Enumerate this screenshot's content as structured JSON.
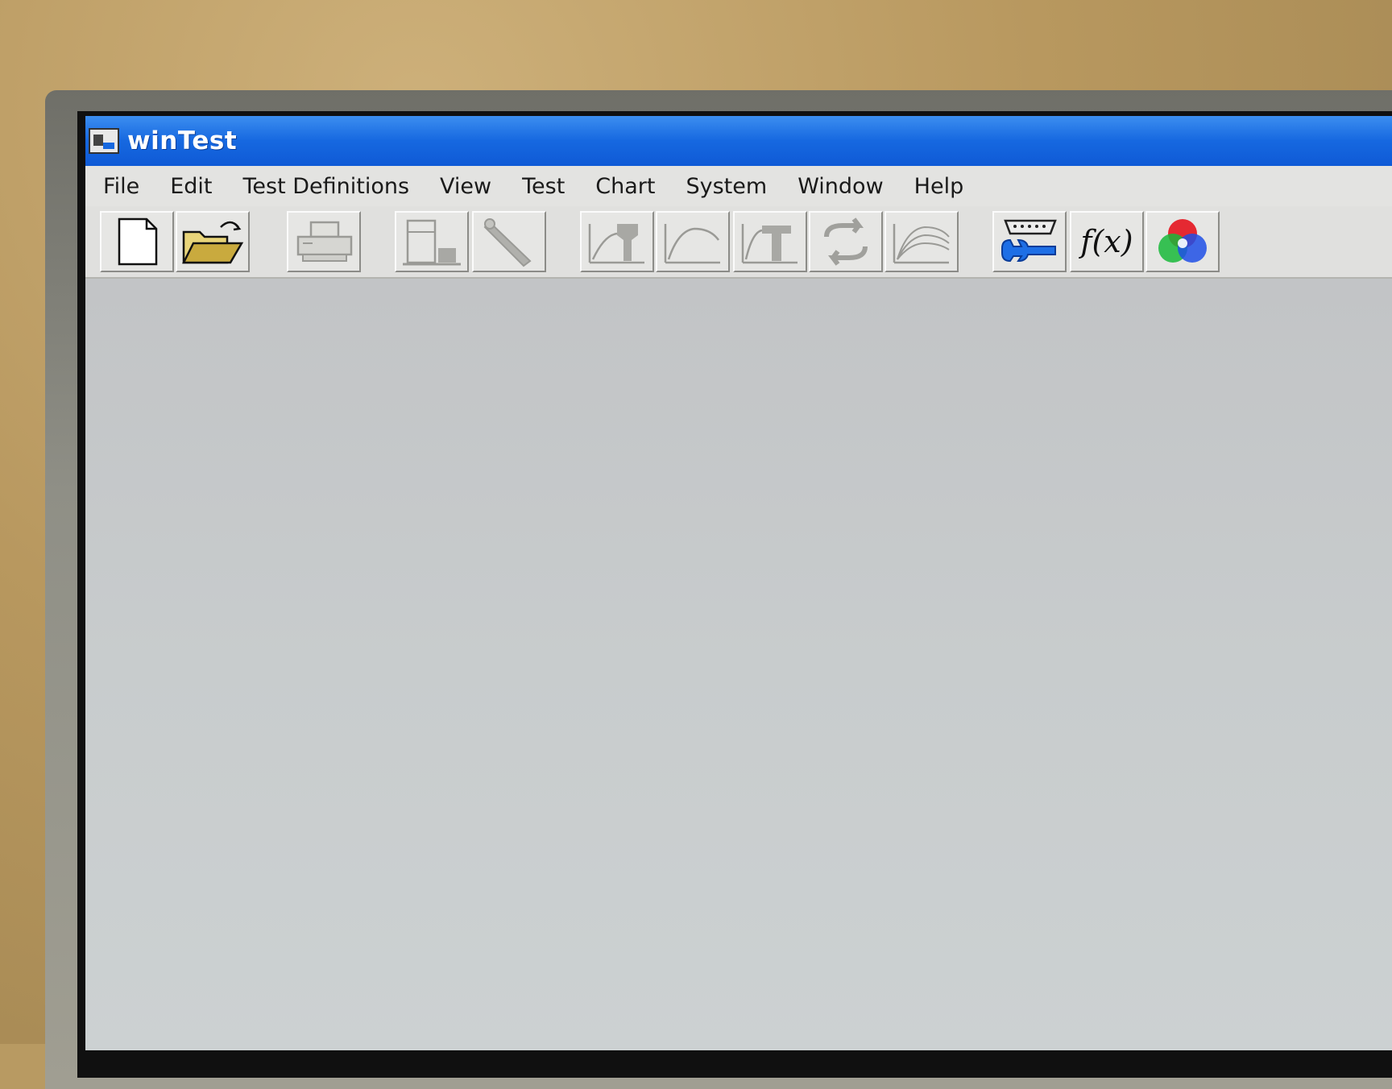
{
  "window": {
    "title": "winTest",
    "icon": "app-window-icon"
  },
  "menu": {
    "items": [
      {
        "label": "File"
      },
      {
        "label": "Edit"
      },
      {
        "label": "Test Definitions"
      },
      {
        "label": "View"
      },
      {
        "label": "Test"
      },
      {
        "label": "Chart"
      },
      {
        "label": "System"
      },
      {
        "label": "Window"
      },
      {
        "label": "Help"
      }
    ]
  },
  "toolbar": {
    "buttons": [
      {
        "icon": "new-document-icon",
        "enabled": true
      },
      {
        "icon": "open-folder-icon",
        "enabled": true
      },
      {
        "icon": "printer-icon",
        "enabled": false
      },
      {
        "icon": "machine-icon",
        "enabled": false
      },
      {
        "icon": "calibrate-probe-icon",
        "enabled": false
      },
      {
        "icon": "start-test-chart-icon",
        "enabled": false
      },
      {
        "icon": "curve-chart-icon",
        "enabled": false
      },
      {
        "icon": "stress-strain-chart-icon",
        "enabled": false
      },
      {
        "icon": "cycle-arrows-icon",
        "enabled": false
      },
      {
        "icon": "overlay-curves-icon",
        "enabled": false
      },
      {
        "icon": "serial-port-wrench-icon",
        "enabled": true
      },
      {
        "icon": "function-fx-icon",
        "enabled": true,
        "text": "f(x)"
      },
      {
        "icon": "color-circles-icon",
        "enabled": true
      }
    ]
  },
  "colors": {
    "titlebar": "#1668e0",
    "disabled_icon": "#9a9a96",
    "client_area": "#c6cbcd"
  }
}
